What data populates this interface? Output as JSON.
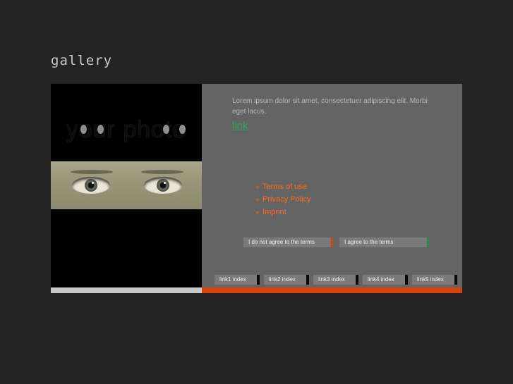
{
  "page": {
    "title": "gallery"
  },
  "photo": {
    "heading": "your photo",
    "image_alt": "eyes photo"
  },
  "content": {
    "intro": "Lorem ipsum dolor sit amet, consectetuer adipiscing elit. Morbi eget lacus.",
    "link_label": "link"
  },
  "terms": {
    "bullet": "»",
    "items": [
      "Terms of use",
      "Privacy Policy",
      "Imprint"
    ],
    "disagree_label": "I do not agree to the terms",
    "agree_label": "I agree to the terms"
  },
  "nav": {
    "links": [
      "link1 index",
      "link2 index",
      "link3 index",
      "link4 index",
      "link5 index"
    ]
  },
  "colors": {
    "background": "#232323",
    "panel": "#646464",
    "accent_orange": "#d8430e",
    "link_green": "#2fa25a"
  }
}
